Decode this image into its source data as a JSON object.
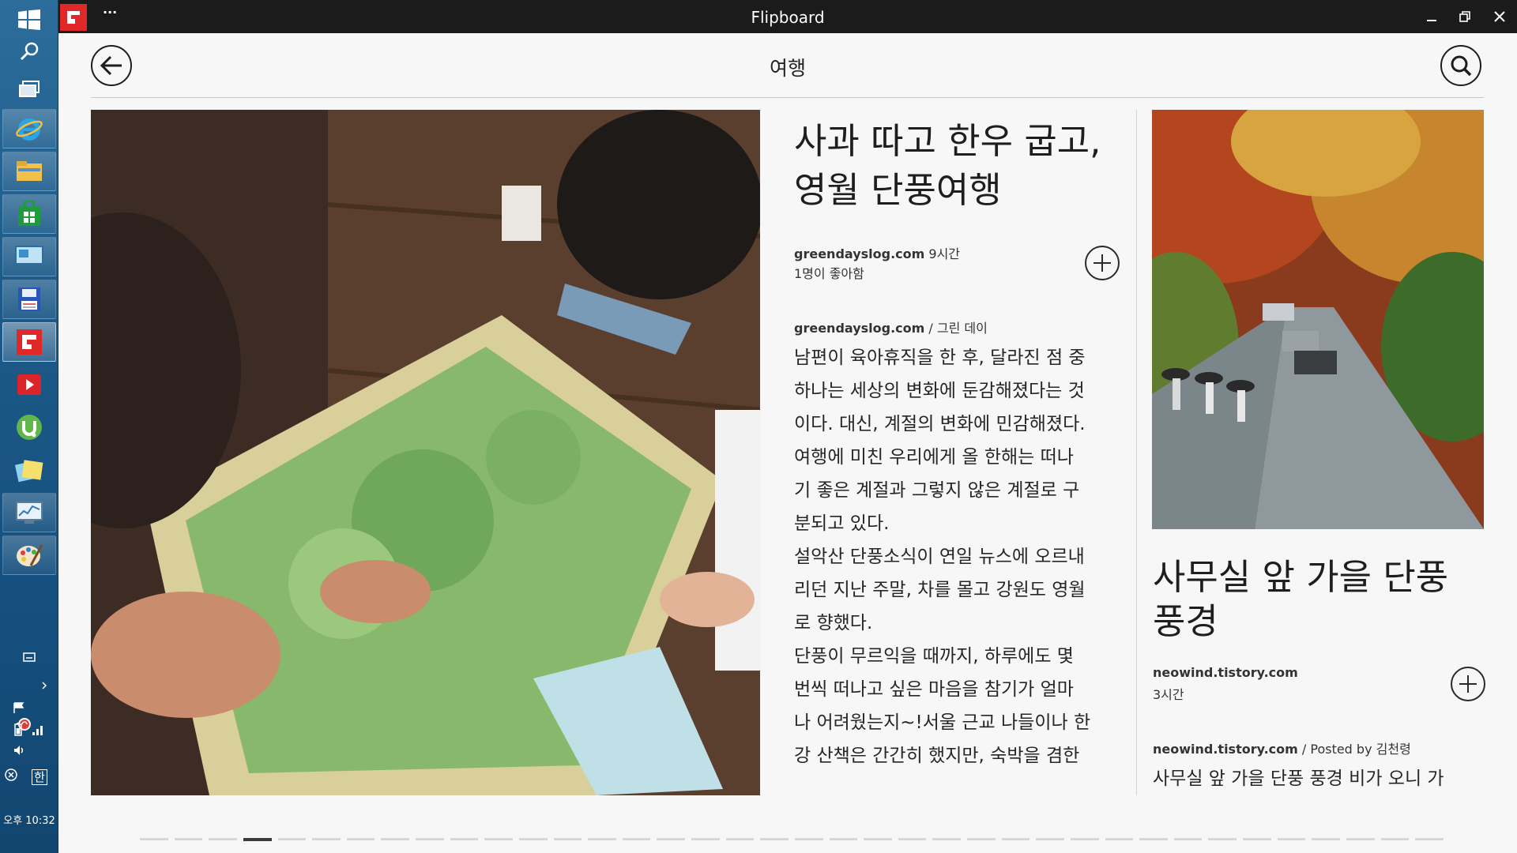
{
  "window": {
    "title": "Flipboard",
    "menu_glyph": "···"
  },
  "taskbar": {
    "clock": "오후 10:32",
    "ime_label": "한"
  },
  "header": {
    "section_title": "여행"
  },
  "article_main": {
    "headline_line1": "사과 따고 한우 굽고,",
    "headline_line2": "영월 단풍여행",
    "source": "greendayslog.com",
    "time_ago": "9시간",
    "likes": "1명이 좋아함",
    "attribution_source": "greendayslog.com",
    "attribution_author": " / 그린 데이",
    "paragraphs": [
      [
        "남편이 육아휴직을 한 후, 달라진 점 중",
        "하나는 세상의 변화에 둔감해졌다는 것",
        "이다. 대신, 계절의 변화에 민감해졌다.",
        "여행에 미친 우리에게 올 한해는 떠나",
        "기 좋은 계절과 그렇지 않은 계절로 구",
        "분되고 있다."
      ],
      [
        "설악산 단풍소식이 연일 뉴스에 오르내",
        "리던 지난 주말, 차를 몰고 강원도 영월",
        "로 향했다."
      ],
      [
        "단풍이 무르익을 때까지, 하루에도 몇",
        "번씩 떠나고 싶은 마음을 참기가 얼마",
        "나 어려웠는지~!서울 근교 나들이나 한",
        "강 산책은 간간히 했지만, 숙박을 겸한"
      ]
    ]
  },
  "article_side": {
    "headline_line1": "사무실 앞 가을 단풍",
    "headline_line2": "풍경",
    "source": "neowind.tistory.com",
    "time_ago": "3시간",
    "attribution_source": "neowind.tistory.com",
    "attribution_author": " / Posted by 김천령",
    "excerpt": "사무실 앞 가을 단풍 풍경 비가 오니 가"
  },
  "pager": {
    "total": 38,
    "active_index": 3
  },
  "colors": {
    "flipboard_red": "#e12828",
    "titlebar": "#1b1b1b",
    "page_bg": "#f7f7f7"
  }
}
